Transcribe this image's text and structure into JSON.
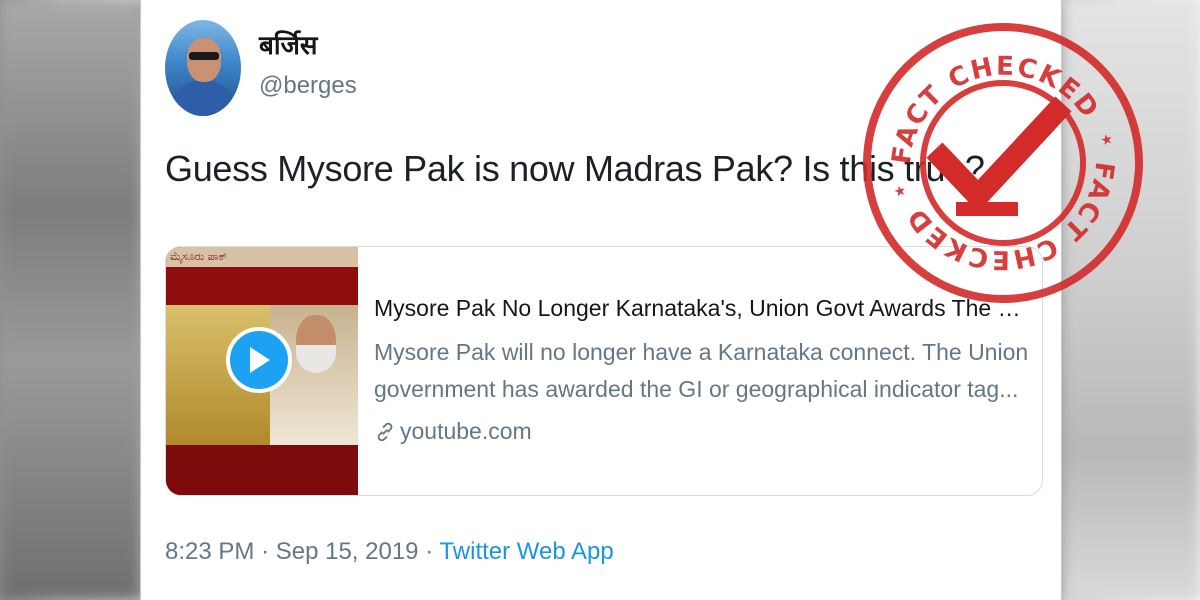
{
  "tweet": {
    "display_name": "बर्जिस",
    "handle": "@berges",
    "text": "Guess Mysore Pak is now Madras Pak? Is this true?",
    "time": "8:23 PM",
    "separator1": "·",
    "date": "Sep 15, 2019",
    "separator2": "·",
    "source": "Twitter Web App"
  },
  "card": {
    "title": "Mysore Pak No Longer Karnataka's, Union Govt Awards The G...",
    "description": "Mysore Pak will no longer have a Karnataka connect. The Union government has awarded the GI or geographical indicator tag...",
    "domain": "youtube.com",
    "play_icon": "play-icon",
    "link_icon": "link-icon"
  },
  "stamp": {
    "top_text": "FACT CHECKED",
    "bottom_text": "FACT CHECKED",
    "color": "#d32a2a"
  },
  "colors": {
    "twitter_blue": "#1da1f2",
    "text_primary": "#14171a",
    "text_secondary": "#657786"
  }
}
